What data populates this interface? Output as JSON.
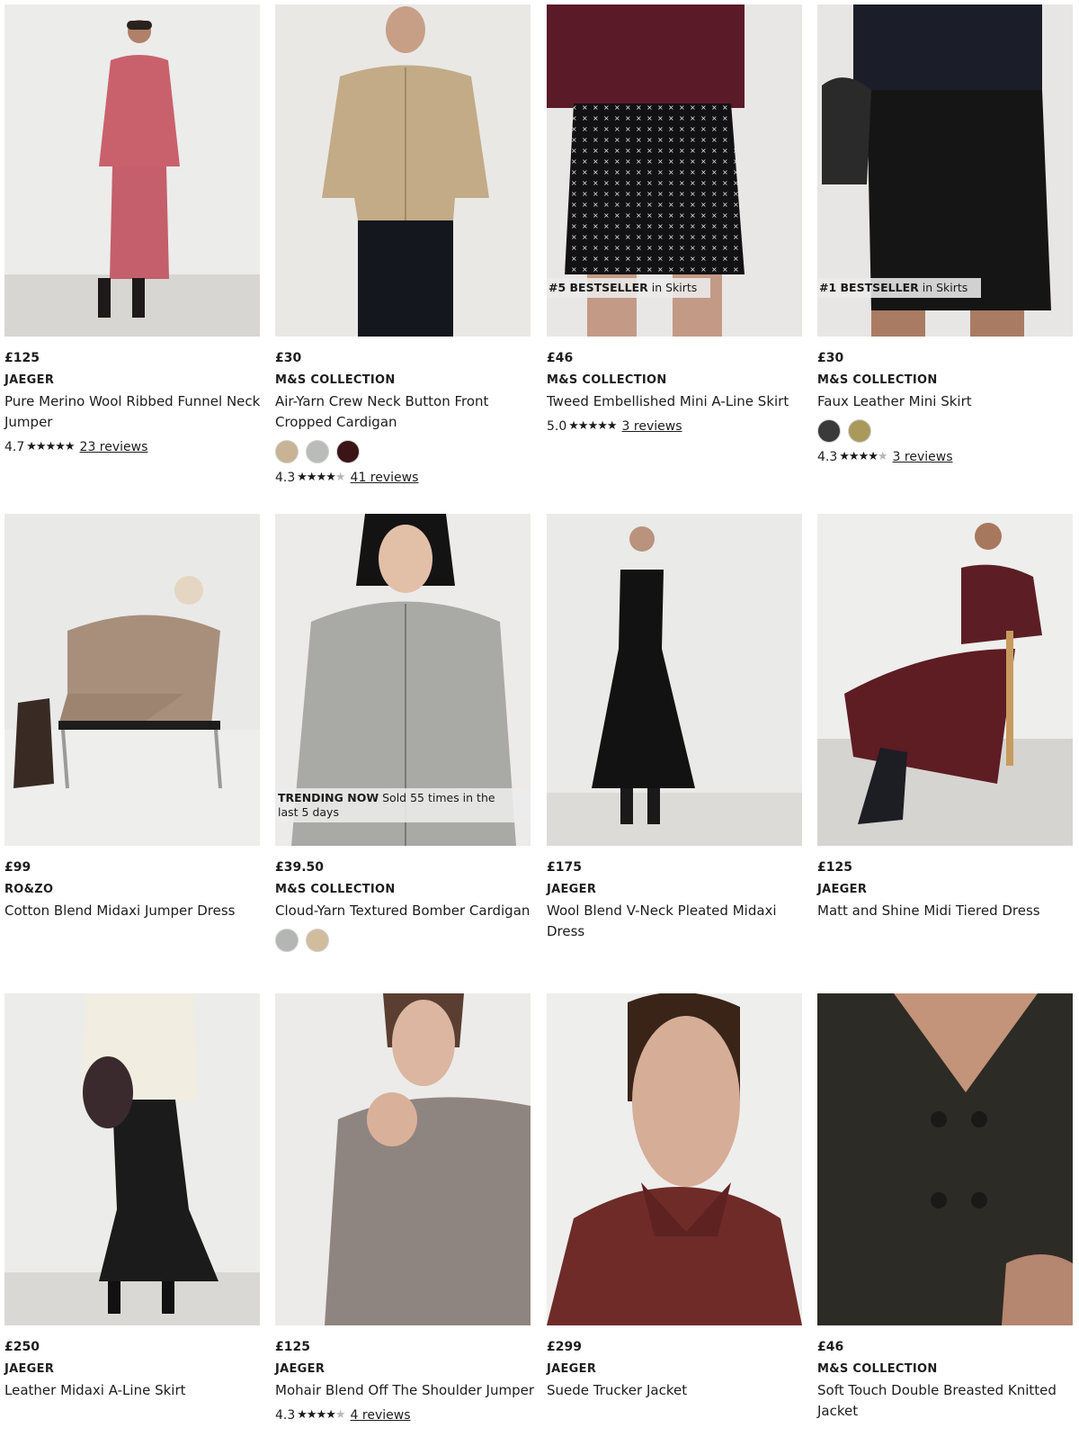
{
  "products": [
    {
      "price": "£125",
      "brand": "JAEGER",
      "name": "Pure Merino Wool Ribbed Funnel Neck Jumper",
      "rating": "4.7",
      "stars": 4.7,
      "reviews": "23 reviews",
      "swatches": [],
      "badge": null
    },
    {
      "price": "£30",
      "brand": "M&S COLLECTION",
      "name": "Air-Yarn Crew Neck Button Front Cropped Cardigan",
      "rating": "4.3",
      "stars": 4.3,
      "reviews": "41 reviews",
      "swatches": [
        "#c9b395",
        "#b9bcb8",
        "#3b1418"
      ],
      "badge": null
    },
    {
      "price": "£46",
      "brand": "M&S COLLECTION",
      "name": "Tweed Embellished Mini A-Line Skirt",
      "rating": "5.0",
      "stars": 5.0,
      "reviews": "3 reviews",
      "swatches": [],
      "badge": {
        "strong": "#5 BESTSELLER",
        "rest": " in Skirts"
      }
    },
    {
      "price": "£30",
      "brand": "M&S COLLECTION",
      "name": "Faux Leather Mini Skirt",
      "rating": "4.3",
      "stars": 4.3,
      "reviews": "3 reviews",
      "swatches": [
        "#3a3a3a",
        "#a99a5b"
      ],
      "badge": {
        "strong": "#1 BESTSELLER",
        "rest": " in Skirts"
      }
    },
    {
      "price": "£99",
      "brand": "RO&ZO",
      "name": "Cotton Blend Midaxi Jumper Dress",
      "rating": null,
      "stars": null,
      "reviews": null,
      "swatches": [],
      "badge": null
    },
    {
      "price": "£39.50",
      "brand": "M&S COLLECTION",
      "name": "Cloud-Yarn Textured Bomber Cardigan",
      "rating": null,
      "stars": null,
      "reviews": null,
      "swatches": [
        "#b4b6b3",
        "#d2bc9e"
      ],
      "badge": {
        "strong": "TRENDING NOW",
        "rest": " Sold 55 times in the last 5 days",
        "wide": true
      }
    },
    {
      "price": "£175",
      "brand": "JAEGER",
      "name": "Wool Blend V-Neck Pleated Midaxi Dress",
      "rating": null,
      "stars": null,
      "reviews": null,
      "swatches": [],
      "badge": null
    },
    {
      "price": "£125",
      "brand": "JAEGER",
      "name": "Matt and Shine Midi Tiered Dress",
      "rating": null,
      "stars": null,
      "reviews": null,
      "swatches": [],
      "badge": null
    },
    {
      "price": "£250",
      "brand": "JAEGER",
      "name": "Leather Midaxi A-Line Skirt",
      "rating": null,
      "stars": null,
      "reviews": null,
      "swatches": [],
      "badge": null
    },
    {
      "price": "£125",
      "brand": "JAEGER",
      "name": "Mohair Blend Off The Shoulder Jumper",
      "rating": "4.3",
      "stars": 4.3,
      "reviews": "4 reviews",
      "swatches": [],
      "badge": null
    },
    {
      "price": "£299",
      "brand": "JAEGER",
      "name": "Suede Trucker Jacket",
      "rating": null,
      "stars": null,
      "reviews": null,
      "swatches": [],
      "badge": null
    },
    {
      "price": "£46",
      "brand": "M&S COLLECTION",
      "name": "Soft Touch Double Breasted Knitted Jacket",
      "rating": null,
      "stars": null,
      "reviews": null,
      "swatches": [],
      "badge": null
    }
  ]
}
